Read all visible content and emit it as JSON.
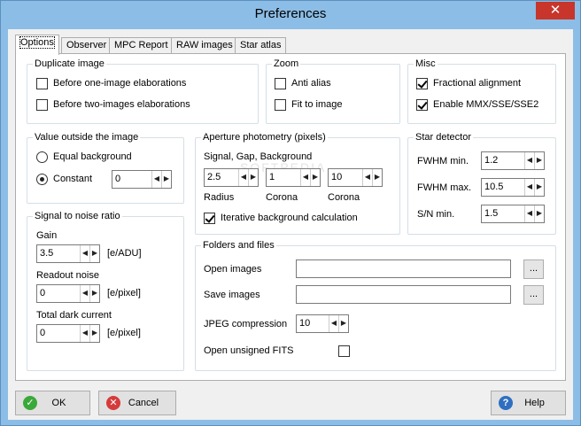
{
  "window": {
    "title": "Preferences",
    "close_glyph": "✕"
  },
  "tabs": [
    "Options",
    "Observer",
    "MPC Report",
    "RAW images",
    "Star atlas"
  ],
  "duplicate_image": {
    "label": "Duplicate image",
    "items": [
      {
        "label": "Before one-image elaborations",
        "checked": false
      },
      {
        "label": "Before two-images elaborations",
        "checked": false
      }
    ]
  },
  "zoom": {
    "label": "Zoom",
    "items": [
      {
        "label": "Anti alias",
        "checked": false
      },
      {
        "label": "Fit to image",
        "checked": false
      }
    ]
  },
  "misc": {
    "label": "Misc",
    "items": [
      {
        "label": "Fractional alignment",
        "checked": true
      },
      {
        "label": "Enable MMX/SSE/SSE2",
        "checked": true
      }
    ]
  },
  "value_outside": {
    "label": "Value outside the image",
    "equal_background": "Equal background",
    "constant": "Constant",
    "constant_value": "0",
    "selected": "constant"
  },
  "aperture": {
    "label": "Aperture photometry (pixels)",
    "subtitle": "Signal, Gap, Background",
    "radius": {
      "label": "Radius",
      "value": "2.5"
    },
    "corona1": {
      "label": "Corona",
      "value": "1"
    },
    "corona2": {
      "label": "Corona",
      "value": "10"
    },
    "iterative": {
      "label": "Iterative background calculation",
      "checked": true
    }
  },
  "star_detector": {
    "label": "Star detector",
    "fwhm_min": {
      "label": "FWHM min.",
      "value": "1.2"
    },
    "fwhm_max": {
      "label": "FWHM max.",
      "value": "10.5"
    },
    "sn_min": {
      "label": "S/N min.",
      "value": "1.5"
    }
  },
  "snr": {
    "label": "Signal to noise ratio",
    "gain": {
      "label": "Gain",
      "value": "3.5",
      "unit": "[e/ADU]"
    },
    "readout": {
      "label": "Readout noise",
      "value": "0",
      "unit": "[e/pixel]"
    },
    "dark": {
      "label": "Total dark current",
      "value": "0",
      "unit": "[e/pixel]"
    }
  },
  "folders": {
    "label": "Folders and files",
    "open_images": {
      "label": "Open images",
      "value": "",
      "browse": "..."
    },
    "save_images": {
      "label": "Save images",
      "value": "",
      "browse": "..."
    },
    "jpeg": {
      "label": "JPEG compression",
      "value": "10"
    },
    "unsigned_fits": {
      "label": "Open unsigned FITS",
      "checked": false
    }
  },
  "spinner": {
    "left": "◀",
    "right": "▶"
  },
  "buttons": {
    "ok": "OK",
    "cancel": "Cancel",
    "help": "Help"
  },
  "icons": {
    "ok": "check-circle-icon",
    "cancel": "x-circle-icon",
    "help": "question-icon"
  },
  "colors": {
    "ok": "#3aa93a",
    "cancel": "#d63b3b",
    "help": "#2f6fc1",
    "titlebar": "#8cbde6"
  }
}
